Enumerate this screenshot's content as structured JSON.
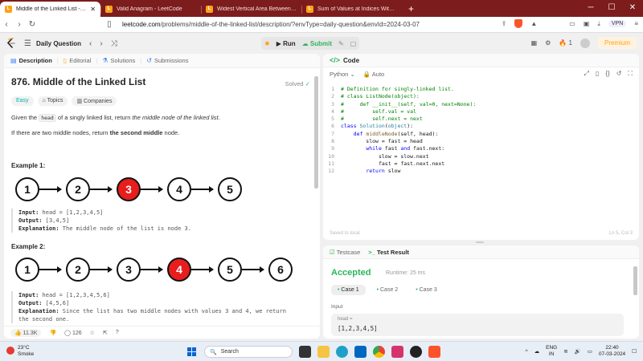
{
  "browser": {
    "tabs": [
      {
        "title": "Middle of the Linked List - LeetC",
        "active": true
      },
      {
        "title": "Valid Anagram - LeetCode",
        "active": false
      },
      {
        "title": "Widest Vertical Area Between Two P",
        "active": false
      },
      {
        "title": "Sum of Values at Indices With K Set",
        "active": false
      }
    ],
    "url_host": "leetcode.com",
    "url_path": "/problems/middle-of-the-linked-list/description/?envType=daily-question&envId=2024-03-07",
    "vpn_label": "VPN"
  },
  "lc_header": {
    "daily_label": "Daily Question",
    "run_label": "Run",
    "submit_label": "Submit",
    "streak_count": "1",
    "premium_label": "Premium"
  },
  "left_tabs": [
    {
      "label": "Description",
      "icon": "document-icon"
    },
    {
      "label": "Editorial",
      "icon": "book-icon"
    },
    {
      "label": "Solutions",
      "icon": "flask-icon"
    },
    {
      "label": "Submissions",
      "icon": "history-icon"
    }
  ],
  "problem": {
    "title": "876. Middle of the Linked List",
    "solved_label": "Solved",
    "difficulty": "Easy",
    "topics_label": "Topics",
    "companies_label": "Companies",
    "para1_pre": "Given the ",
    "para1_code": "head",
    "para1_mid": " of a singly linked list, return ",
    "para1_em": "the middle node of the linked list",
    "para1_end": ".",
    "para2_pre": "If there are two middle nodes, return ",
    "para2_bold": "the second middle",
    "para2_end": " node.",
    "example1": {
      "heading": "Example 1:",
      "nodes": [
        "1",
        "2",
        "3",
        "4",
        "5"
      ],
      "highlight_index": 2,
      "input_label": "Input:",
      "input": "head = [1,2,3,4,5]",
      "output_label": "Output:",
      "output": "[3,4,5]",
      "expl_label": "Explanation:",
      "explanation": "The middle node of the list is node 3."
    },
    "example2": {
      "heading": "Example 2:",
      "nodes": [
        "1",
        "2",
        "3",
        "4",
        "5",
        "6"
      ],
      "highlight_index": 3,
      "input_label": "Input:",
      "input": "head = [1,2,3,4,5,6]",
      "output_label": "Output:",
      "output": "[4,5,6]",
      "expl_label": "Explanation:",
      "explanation": "Since the list has two middle nodes with values 3 and 4, we return",
      "explanation2": "the second one."
    },
    "likes": "11.3K",
    "comments": "126"
  },
  "code": {
    "title": "Code",
    "language": "Python",
    "auto_label": "Auto",
    "lines": [
      "# Definition for singly-linked list.",
      "# class ListNode(object):",
      "#     def __init__(self, val=0, next=None):",
      "#         self.val = val",
      "#         self.next = next",
      "class Solution(object):",
      "    def middleNode(self, head):",
      "        slow = fast = head",
      "        while fast and fast.next:",
      "            slow = slow.next",
      "            fast = fast.next.next",
      "        return slow"
    ],
    "saved_label": "Saved to local",
    "cursor_pos": "Ln 5, Col 3"
  },
  "test": {
    "testcase_tab": "Testcase",
    "result_tab": "Test Result",
    "status": "Accepted",
    "runtime": "Runtime: 25 ms",
    "cases": [
      "Case 1",
      "Case 2",
      "Case 3"
    ],
    "input_label": "Input",
    "var_name": "head =",
    "var_value": "[1,2,3,4,5]"
  },
  "taskbar": {
    "temp": "23°C",
    "weather": "Smoke",
    "search_label": "Search",
    "lang": "ENG",
    "region": "IN",
    "time": "22:40",
    "date": "07-03-2024"
  },
  "colors": {
    "accepted": "#2db55d",
    "highlight_node": "#e81d1d",
    "brand": "#ffa116",
    "tabbar": "#7d1c1c"
  }
}
